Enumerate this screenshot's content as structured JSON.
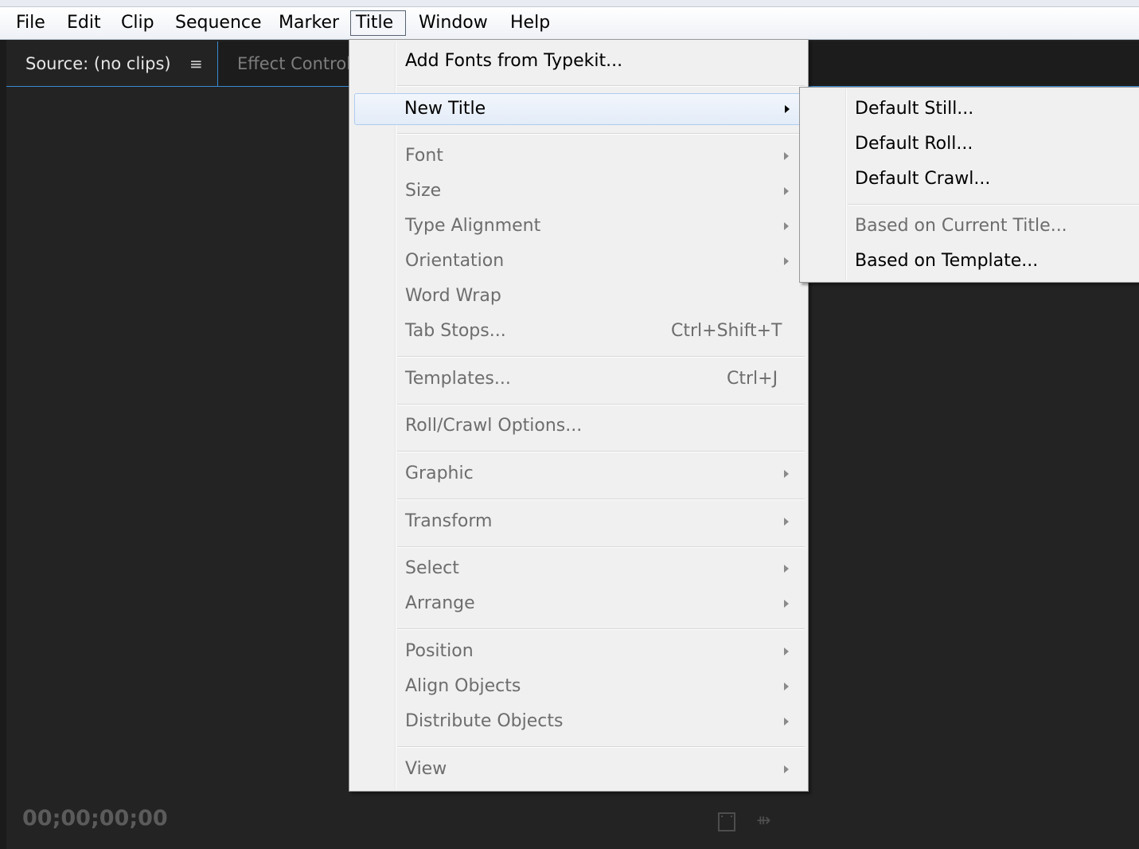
{
  "menubar": {
    "items": [
      "File",
      "Edit",
      "Clip",
      "Sequence",
      "Marker",
      "Title",
      "Window",
      "Help"
    ],
    "active": "Title"
  },
  "panel": {
    "active_tab": "Source: (no clips)",
    "inactive_tab": "Effect Control",
    "menu_icon": "≡",
    "timecode": "00;00;00;00"
  },
  "title_menu": {
    "add_fonts": "Add Fonts from Typekit...",
    "new_title": "New Title",
    "font": "Font",
    "size": "Size",
    "type_alignment": "Type Alignment",
    "orientation": "Orientation",
    "word_wrap": "Word Wrap",
    "tab_stops": "Tab Stops...",
    "tab_stops_shortcut": "Ctrl+Shift+T",
    "templates": "Templates...",
    "templates_shortcut": "Ctrl+J",
    "roll_crawl": "Roll/Crawl Options...",
    "graphic": "Graphic",
    "transform": "Transform",
    "select": "Select",
    "arrange": "Arrange",
    "position": "Position",
    "align_objects": "Align Objects",
    "distribute_objects": "Distribute Objects",
    "view": "View"
  },
  "new_title_submenu": {
    "default_still": "Default Still...",
    "default_roll": "Default Roll...",
    "default_crawl": "Default Crawl...",
    "based_on_current": "Based on Current Title...",
    "based_on_template": "Based on Template..."
  },
  "icons": {
    "submenu_arrow": "submenu-arrow-icon",
    "film": "film-strip-icon",
    "insert": "insert-icon"
  },
  "colors": {
    "panel_bg": "#232323",
    "accent_blue": "#3a8ad1",
    "menu_bg": "#f0f0f0",
    "disabled_text": "#6d6d6d"
  }
}
